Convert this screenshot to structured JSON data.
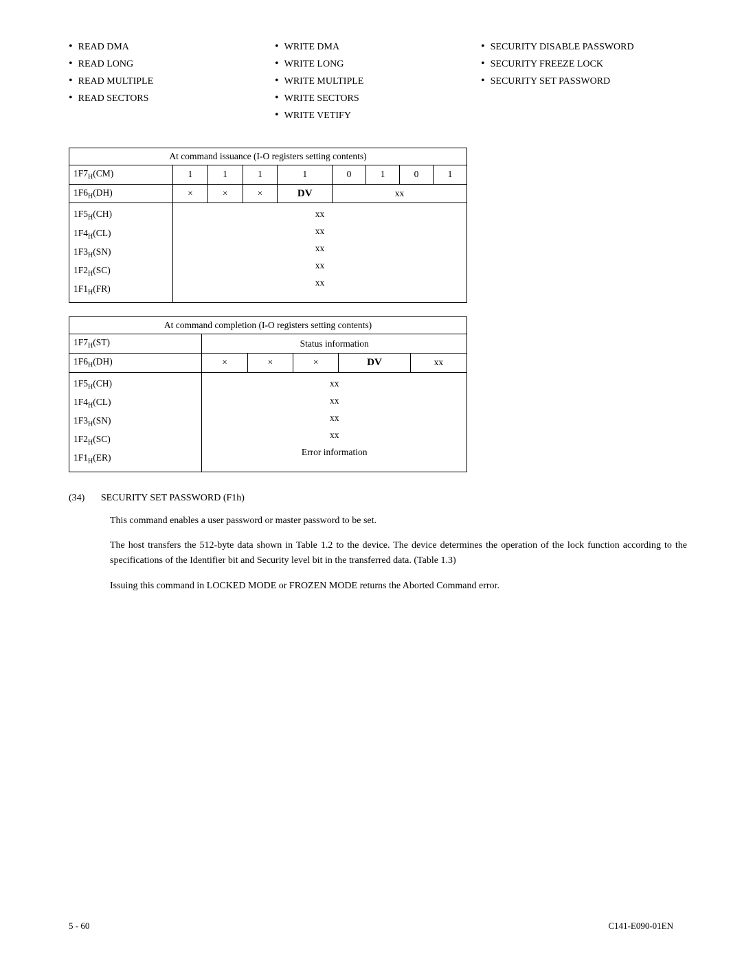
{
  "bullet_columns": [
    {
      "id": "col1",
      "items": [
        "READ DMA",
        "READ LONG",
        "READ MULTIPLE",
        "READ SECTORS"
      ]
    },
    {
      "id": "col2",
      "items": [
        "WRITE DMA",
        "WRITE LONG",
        "WRITE MULTIPLE",
        "WRITE SECTORS",
        "WRITE VETIFY"
      ]
    },
    {
      "id": "col3",
      "items": [
        "SECURITY DISABLE PASSWORD",
        "SECURITY FREEZE LOCK",
        "SECURITY SET PASSWORD"
      ]
    }
  ],
  "table_issuance": {
    "header": "At command issuance (I-O registers setting contents)",
    "rows": [
      {
        "label": "1F7H(CM)",
        "cells": [
          "1",
          "1",
          "1",
          "1",
          "0",
          "1",
          "0",
          "1"
        ]
      },
      {
        "label": "1F6H(DH)",
        "cells": [
          "×",
          "×",
          "×",
          "DV",
          "",
          "xx",
          "",
          ""
        ]
      }
    ],
    "multi_regs": [
      "1F5H(CH)",
      "1F4H(CL)",
      "1F3H(SN)",
      "1F2H(SC)",
      "1F1H(FR)"
    ],
    "multi_xx": "xx"
  },
  "table_completion": {
    "header": "At command completion (I-O registers setting contents)",
    "rows": [
      {
        "label": "1F7H(ST)",
        "span_label": "Status information"
      },
      {
        "label": "1F6H(DH)",
        "cells": [
          "×",
          "×",
          "×",
          "DV",
          "",
          "xx",
          "",
          ""
        ]
      }
    ],
    "multi_regs": [
      "1F5H(CH)",
      "1F4H(CL)",
      "1F3H(SN)",
      "1F2H(SC)",
      "1F1H(ER)"
    ],
    "multi_xx": "xx",
    "er_label": "Error information"
  },
  "section": {
    "number": "(34)",
    "title": "SECURITY SET PASSWORD (F1h)"
  },
  "paragraphs": [
    "This command enables a user password or master password to be set.",
    "The host transfers the 512-byte data shown in Table 1.2 to the device.  The device determines the operation of the lock function according to the specifications of the Identifier bit and Security level bit in the transferred data.  (Table 1.3)",
    "Issuing this command in LOCKED MODE or FROZEN MODE returns the Aborted Command error."
  ],
  "footer": {
    "left": "5 - 60",
    "right": "C141-E090-01EN"
  }
}
